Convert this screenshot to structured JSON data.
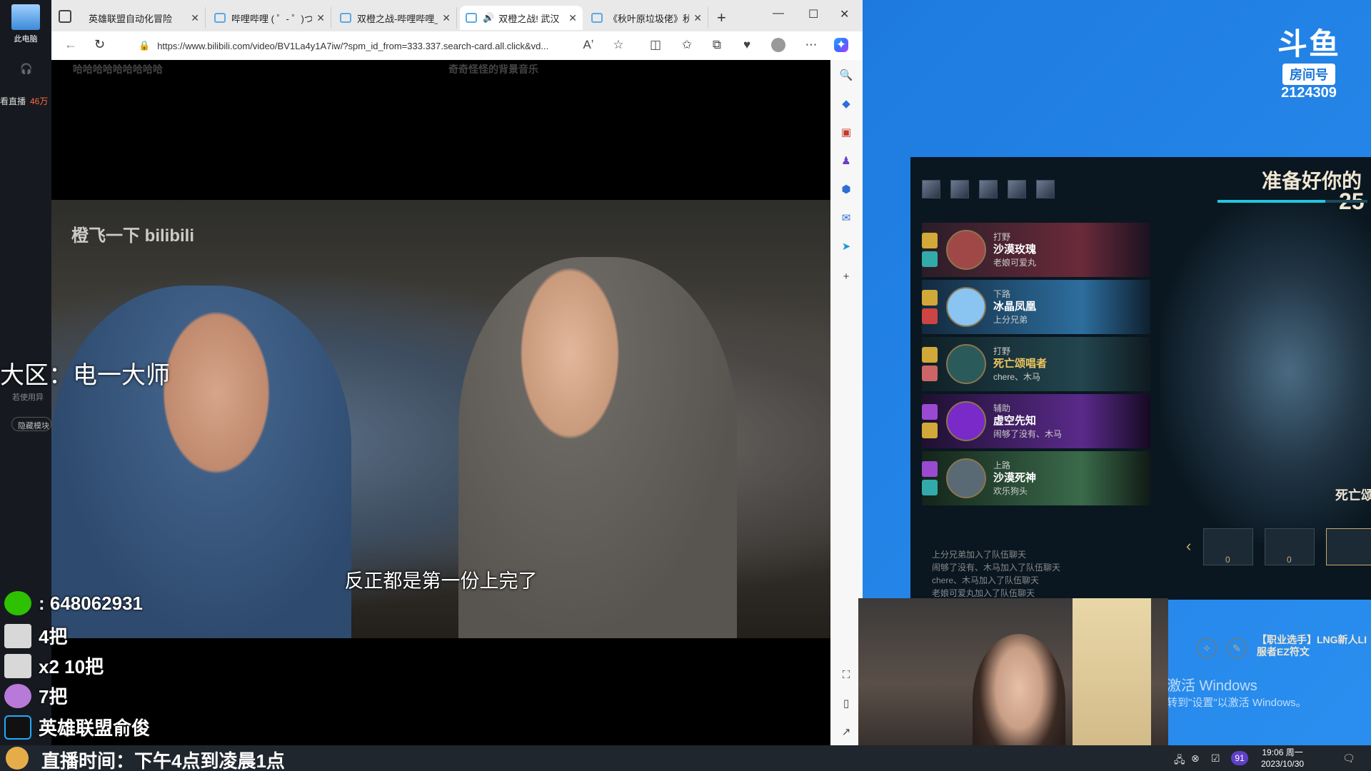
{
  "desktop": {
    "pc_label": "此电脑"
  },
  "left_panel": {
    "label": "看直播",
    "count": "46万",
    "hint": "若使用异",
    "button": "隐藏模块"
  },
  "browser": {
    "tabs": [
      {
        "title": "英雄联盟自动化冒险",
        "icon": "lol-icon"
      },
      {
        "title": "哔哩哔哩 ( ゜- ゜)つロ",
        "icon": "bilibili-icon"
      },
      {
        "title": "双橙之战-哔哩哔哩_",
        "icon": "bilibili-icon"
      },
      {
        "title": "双橙之战! 武汉",
        "icon": "bilibili-icon",
        "active": true
      },
      {
        "title": "《秋叶原垃圾佬》秋",
        "icon": "bilibili-icon"
      }
    ],
    "url": "https://www.bilibili.com/video/BV1La4y1A7iw/?spm_id_from=333.337.search-card.all.click&vd...",
    "video": {
      "top_left_text": "哈哈哈哈哈哈哈哈哈",
      "top_center_text": "奇奇怪怪的背景音乐",
      "watermark": "橙飞一下 bilibili",
      "subtitle": "反正都是第一份上完了"
    }
  },
  "stream_overlay": {
    "region": "大区：电一大师",
    "wechat": ": 648062931",
    "plane_1": "4把",
    "plane_2": "x2 10把",
    "medal": "7把",
    "douyin": "英雄联盟俞俊",
    "live_time": "直播时间：下午4点到凌晨1点"
  },
  "douyu": {
    "logo": "斗鱼",
    "room_label": "房间号",
    "room_number": "2124309"
  },
  "lol": {
    "ready_text": "准备好你的",
    "timer": "25",
    "timer_progress": 0.72,
    "team": [
      {
        "role": "打野",
        "champion": "沙漠玫瑰",
        "player": "老娘可爱丸"
      },
      {
        "role": "下路",
        "champion": "冰晶凤凰",
        "player": "上分兄弟"
      },
      {
        "role": "打野",
        "champion": "死亡颂唱者",
        "player": "chere、木马"
      },
      {
        "role": "辅助",
        "champion": "虚空先知",
        "player": "闹够了没有、木马"
      },
      {
        "role": "上路",
        "champion": "沙漠死神",
        "player": "欢乐狗头"
      }
    ],
    "chat": [
      "上分兄弟加入了队伍聊天",
      "闹够了没有、木马加入了队伍聊天",
      "chere、木马加入了队伍聊天",
      "老娘可爱丸加入了队伍聊天"
    ],
    "splash_name": "死亡颂",
    "skin_counts": [
      "0",
      "0"
    ],
    "pro_tag": "【职业选手】LNG新人LI",
    "pro_tag_2": "服者EZ符文"
  },
  "activation": {
    "title": "激活 Windows",
    "sub": "转到\"设置\"以激活 Windows。"
  },
  "taskbar": {
    "badge": "91",
    "time": "19:06 周一",
    "date": "2023/10/30"
  }
}
